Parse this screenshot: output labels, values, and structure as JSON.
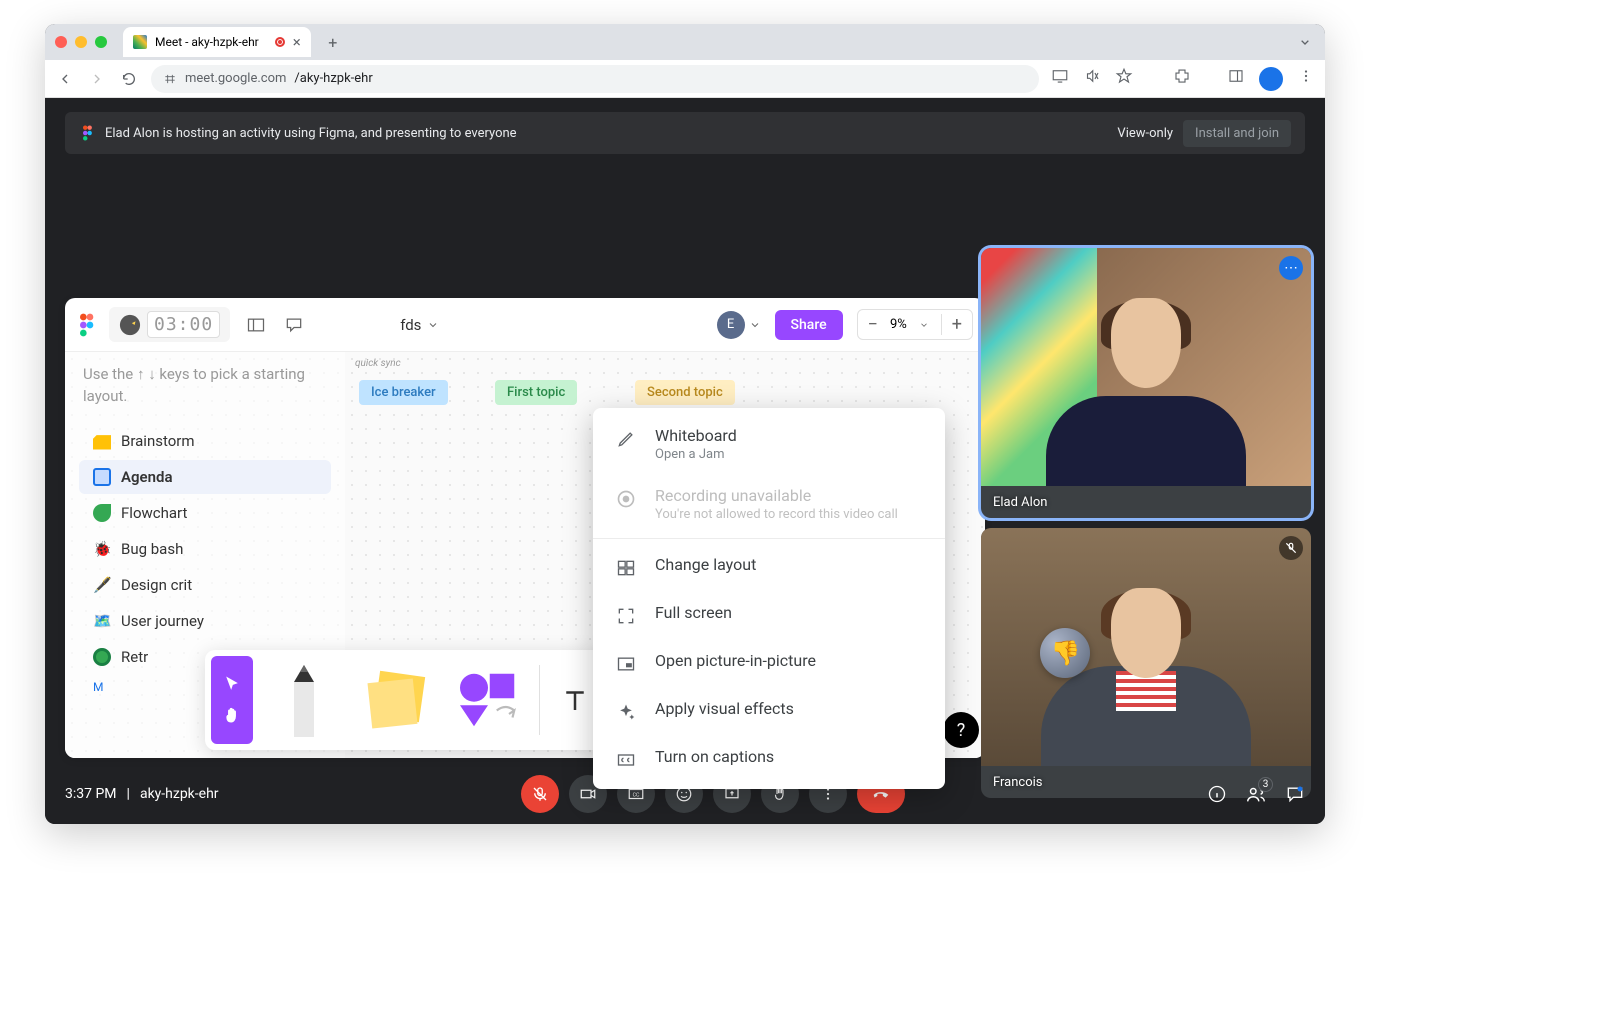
{
  "browser": {
    "tab_favicon": "meet",
    "tab_title": "Meet - aky-hzpk-ehr",
    "url_domain": "meet.google.com",
    "url_path": "/aky-hzpk-ehr"
  },
  "banner": {
    "text": "Elad Alon is hosting an activity using Figma, and presenting to everyone",
    "view_only": "View-only",
    "install_join": "Install and join"
  },
  "figma": {
    "timer": "03:00",
    "file_name": "fds",
    "user_initial": "E",
    "share": "Share",
    "zoom": "9%",
    "hint": "Use the ↑ ↓ keys to pick a starting layout.",
    "templates": [
      {
        "icon": "#ffc107",
        "label": "Brainstorm"
      },
      {
        "icon": "#1a73e8",
        "label": "Agenda",
        "selected": true
      },
      {
        "icon": "#34a853",
        "label": "Flowchart"
      },
      {
        "icon": "#ea4335",
        "label": "Bug bash"
      },
      {
        "icon": "#9747ff",
        "label": "Design crit"
      },
      {
        "icon": "#673ab7",
        "label": "User journey"
      },
      {
        "icon": "#34a853",
        "label": "Retr"
      }
    ],
    "more": "M",
    "canvas_label": "quick sync",
    "agenda_pills": {
      "ice_breaker": "Ice breaker",
      "first_topic": "First topic",
      "second_topic": "Second topic"
    },
    "toolbar": [
      "cursor",
      "hand",
      "pencil",
      "sticky",
      "shapes",
      "text"
    ]
  },
  "menu": {
    "items": [
      {
        "title": "Whiteboard",
        "subtitle": "Open a Jam",
        "icon": "pencil",
        "enabled": true
      },
      {
        "title": "Recording unavailable",
        "subtitle": "You're not allowed to record this video call",
        "icon": "record",
        "enabled": false
      }
    ],
    "separator": true,
    "items2": [
      {
        "title": "Change layout",
        "icon": "layout"
      },
      {
        "title": "Full screen",
        "icon": "fullscreen"
      },
      {
        "title": "Open picture-in-picture",
        "icon": "pip"
      },
      {
        "title": "Apply visual effects",
        "icon": "sparkle"
      },
      {
        "title": "Turn on captions",
        "icon": "cc"
      }
    ]
  },
  "participants": [
    {
      "name": "Elad Alon",
      "talking": true,
      "muted": false
    },
    {
      "name": "Francois",
      "talking": false,
      "muted": true,
      "reaction": "thumbs-down"
    }
  ],
  "bottom": {
    "time": "3:37 PM",
    "code": "aky-hzpk-ehr",
    "people_count": "3"
  }
}
